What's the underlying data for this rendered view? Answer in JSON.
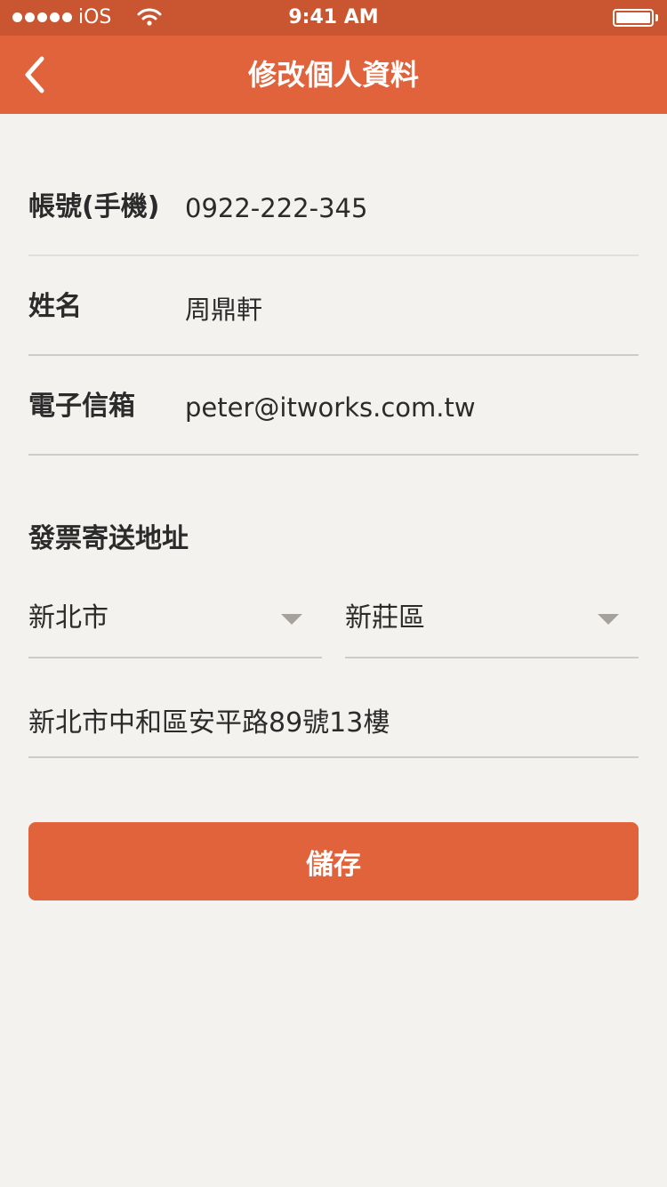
{
  "status_bar": {
    "carrier": "iOS",
    "time": "9:41 AM"
  },
  "nav": {
    "title": "修改個人資料",
    "back_icon": "chevron-left-icon"
  },
  "form": {
    "account": {
      "label": "帳號(手機)",
      "value": "0922-222-345"
    },
    "name": {
      "label": "姓名",
      "value": "周鼎軒"
    },
    "email": {
      "label": "電子信箱",
      "value": "peter@itworks.com.tw"
    }
  },
  "invoice": {
    "section_title": "發票寄送地址",
    "city": {
      "value": "新北市"
    },
    "district": {
      "value": "新莊區"
    },
    "address": {
      "value": "新北市中和區安平路89號13樓"
    }
  },
  "actions": {
    "save_label": "儲存"
  },
  "colors": {
    "status_bar": "#c95631",
    "nav_bar": "#e1633c",
    "primary_button": "#e1633c",
    "background": "#f4f2ee"
  }
}
